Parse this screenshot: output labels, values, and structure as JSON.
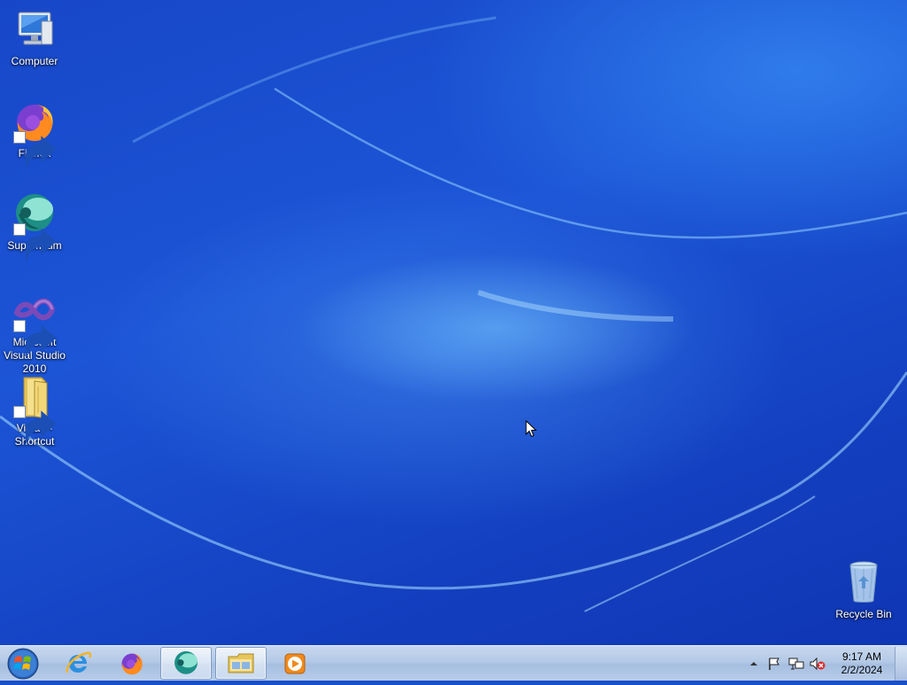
{
  "desktop": {
    "icons": [
      {
        "label": "Computer",
        "icon": "computer-icon"
      },
      {
        "label": "Firefox",
        "icon": "firefox-icon"
      },
      {
        "label": "Supermium",
        "icon": "supermium-icon"
      },
      {
        "label": "Microsoft Visual Studio 2010",
        "icon": "visual-studio-icon"
      },
      {
        "label": "Vista7 - Shortcut",
        "icon": "folder-icon"
      }
    ],
    "recycle_bin": {
      "label": "Recycle Bin",
      "icon": "recycle-bin-icon"
    }
  },
  "taskbar": {
    "start": {
      "icon": "windows-start-icon"
    },
    "buttons": [
      {
        "app": "Internet Explorer",
        "icon": "internet-explorer-icon",
        "open": false
      },
      {
        "app": "Firefox",
        "icon": "firefox-icon",
        "open": false
      },
      {
        "app": "Supermium",
        "icon": "supermium-icon",
        "open": true
      },
      {
        "app": "Windows Explorer",
        "icon": "folder-icon",
        "open": true
      },
      {
        "app": "Windows Media Player",
        "icon": "media-player-icon",
        "open": false
      }
    ],
    "tray": {
      "icons": [
        "show-hidden-icons-arrow",
        "action-center-flag-icon",
        "network-icon",
        "volume-muted-icon"
      ],
      "time": "9:17 AM",
      "date": "2/2/2024"
    }
  },
  "colors": {
    "desktop_blue": "#1a4fc9",
    "taskbar": "#b4c9e6"
  }
}
